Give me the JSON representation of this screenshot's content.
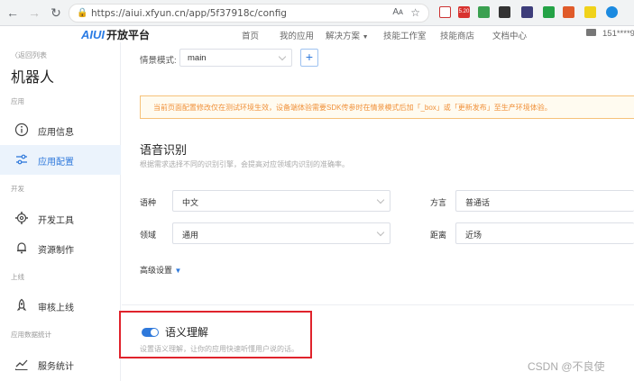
{
  "browser": {
    "url": "https://aiui.xfyun.cn/app/5f37918c/config",
    "reader_label": "Aᴀ",
    "badge": "5.20"
  },
  "site": {
    "logo_mark": "AIUI",
    "logo_text": "开放平台",
    "nav": [
      "首页",
      "我的应用",
      "解决方案",
      "技能工作室",
      "技能商店",
      "文档中心"
    ],
    "user": "151****9"
  },
  "sidebar": {
    "back": "〈返回列表",
    "app_name": "机器人",
    "sections": [
      "应用",
      "开发",
      "上线",
      "应用数据统计"
    ],
    "items": [
      {
        "label": "应用信息",
        "icon": "info-icon"
      },
      {
        "label": "应用配置",
        "icon": "settings-sliders-icon"
      },
      {
        "label": "开发工具",
        "icon": "gear-icon"
      },
      {
        "label": "资源制作",
        "icon": "bell-icon"
      },
      {
        "label": "审核上线",
        "icon": "rocket-icon"
      },
      {
        "label": "服务统计",
        "icon": "chart-line-icon"
      }
    ]
  },
  "main": {
    "mode_label": "情景模式:",
    "mode_value": "main",
    "add_symbol": "+",
    "notice": "当前页面配置修改仅在测试环境生效，设备端体验需要SDK传参时在情景模式后加「_box」或「更新发布」至生产环境体验。",
    "asr_title": "语音识别",
    "asr_desc": "根据需求选择不同的识别引擎，会提高对应领域内识别的准确率。",
    "fields": {
      "lang_label": "语种",
      "lang_value": "中文",
      "dialect_label": "方言",
      "dialect_value": "普通话",
      "domain_label": "领域",
      "domain_value": "通用",
      "distance_label": "距离",
      "distance_value": "近场"
    },
    "advanced": "高级设置",
    "nlu_title": "语义理解",
    "nlu_desc": "设置语义理解，让你的应用快速听懂用户说的话。"
  },
  "watermark": "CSDN @不良使",
  "colors": {
    "accent": "#2f79db",
    "notice_text": "#f0913a",
    "highlight_box": "#e0232c"
  }
}
